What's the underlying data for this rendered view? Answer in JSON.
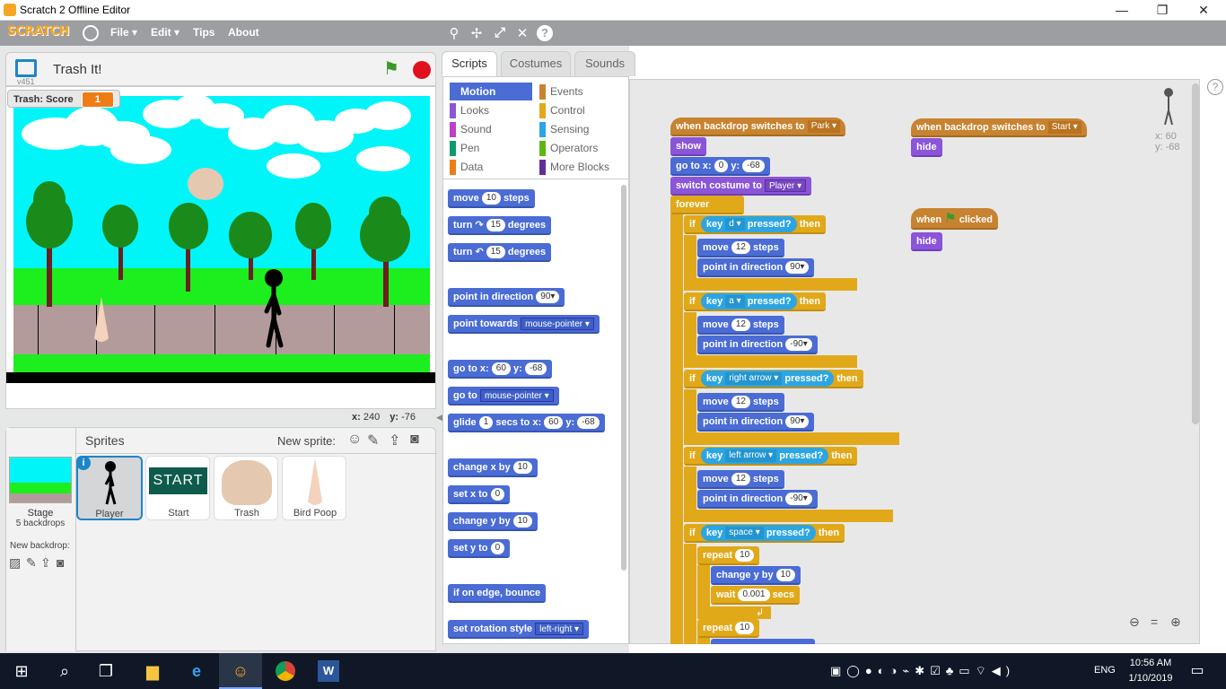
{
  "window": {
    "title": "Scratch 2 Offline Editor",
    "minimize": "—",
    "restore": "❐",
    "close": "✕"
  },
  "menubar": {
    "logo": "SCRATCH",
    "file": "File ▾",
    "edit": "Edit ▾",
    "tips": "Tips",
    "about": "About"
  },
  "stage": {
    "project_title": "Trash It!",
    "version": "v451",
    "score_label": "Trash: Score",
    "score_value": "1",
    "coords_x_label": "x:",
    "coords_x": "240",
    "coords_y_label": "y:",
    "coords_y": "-76"
  },
  "sprites_panel": {
    "title": "Sprites",
    "new_sprite": "New sprite:",
    "stage_label": "Stage",
    "stage_backdrops": "5 backdrops",
    "new_backdrop": "New backdrop:",
    "items": [
      {
        "name": "Player",
        "selected": true
      },
      {
        "name": "Start"
      },
      {
        "name": "Trash"
      },
      {
        "name": "Bird Poop"
      }
    ],
    "start_thumb_text": "START"
  },
  "tabs": [
    "Scripts",
    "Costumes",
    "Sounds"
  ],
  "categories": {
    "left": [
      "Motion",
      "Looks",
      "Sound",
      "Pen",
      "Data"
    ],
    "right": [
      "Events",
      "Control",
      "Sensing",
      "Operators",
      "More Blocks"
    ],
    "colors": {
      "Motion": "#4a6cd4",
      "Looks": "#8a55d7",
      "Sound": "#bb42c3",
      "Pen": "#0e9a6c",
      "Data": "#ee7d16",
      "Events": "#c88330",
      "Control": "#e1a91a",
      "Sensing": "#2ca5e2",
      "Operators": "#5cb712",
      "More Blocks": "#632d99"
    }
  },
  "palette_blocks": {
    "move": {
      "a": "move",
      "n": "10",
      "b": "steps"
    },
    "turn_r": {
      "a": "turn",
      "icon": "↷",
      "n": "15",
      "b": "degrees"
    },
    "turn_l": {
      "a": "turn",
      "icon": "↶",
      "n": "15",
      "b": "degrees"
    },
    "point_dir": {
      "a": "point in direction",
      "v": "90▾"
    },
    "point_towards": {
      "a": "point towards",
      "v": "mouse-pointer ▾"
    },
    "goto_xy": {
      "a": "go to x:",
      "x": "60",
      "b": "y:",
      "y": "-68"
    },
    "goto": {
      "a": "go to",
      "v": "mouse-pointer ▾"
    },
    "glide": {
      "a": "glide",
      "n": "1",
      "b": "secs to x:",
      "x": "60",
      "c": "y:",
      "y": "-68"
    },
    "change_x": {
      "a": "change x by",
      "n": "10"
    },
    "set_x": {
      "a": "set x to",
      "n": "0"
    },
    "change_y": {
      "a": "change y by",
      "n": "10"
    },
    "set_y": {
      "a": "set y to",
      "n": "0"
    },
    "bounce": {
      "a": "if on edge, bounce"
    },
    "rotation": {
      "a": "set rotation style",
      "v": "left-right ▾"
    }
  },
  "scripts": {
    "hat1": {
      "a": "when backdrop switches to",
      "v": "Park ▾"
    },
    "show": "show",
    "goto": {
      "a": "go to x:",
      "x": "0",
      "b": "y:",
      "y": "-68"
    },
    "costume": {
      "a": "switch costume to",
      "v": "Player ▾"
    },
    "forever": "forever",
    "if": "if",
    "then": "then",
    "key": "key",
    "pressed": "pressed?",
    "keys": [
      "d ▾",
      "a ▾",
      "right arrow ▾",
      "left arrow ▾",
      "space ▾"
    ],
    "move": "move",
    "steps": "steps",
    "twelve": "12",
    "point": "point in direction",
    "dir90": "90▾",
    "dirm90": "-90▾",
    "repeat": "repeat",
    "ten": "10",
    "change_y": "change y by",
    "wait": "wait",
    "wait_val": "0.001",
    "secs": "secs",
    "hat2": {
      "a": "when backdrop switches to",
      "v": "Start ▾"
    },
    "hide": "hide",
    "hat3": {
      "a": "when",
      "b": "clicked"
    }
  },
  "sprite_info": {
    "x_label": "x:",
    "x": "60",
    "y_label": "y:",
    "y": "-68"
  },
  "taskbar": {
    "time": "10:56 AM",
    "date": "1/10/2019",
    "lang": "ENG"
  }
}
